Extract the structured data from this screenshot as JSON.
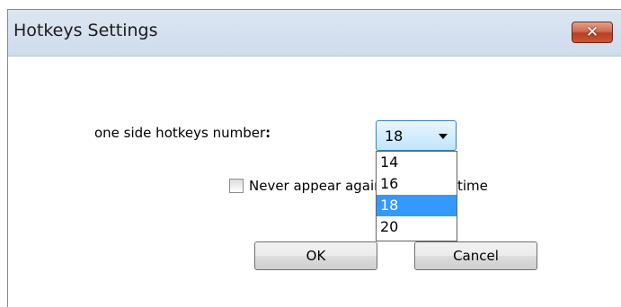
{
  "window": {
    "title": "Hotkeys Settings",
    "close_label": "✕"
  },
  "form": {
    "hotkeys_label": "one side hotkeys number",
    "colon": ":",
    "selected_value": "18",
    "options": [
      "14",
      "16",
      "18",
      "20"
    ],
    "never_appear_label": "Never appear again at startup time",
    "never_appear_checked": false
  },
  "buttons": {
    "ok_label": "OK",
    "cancel_label": "Cancel"
  }
}
